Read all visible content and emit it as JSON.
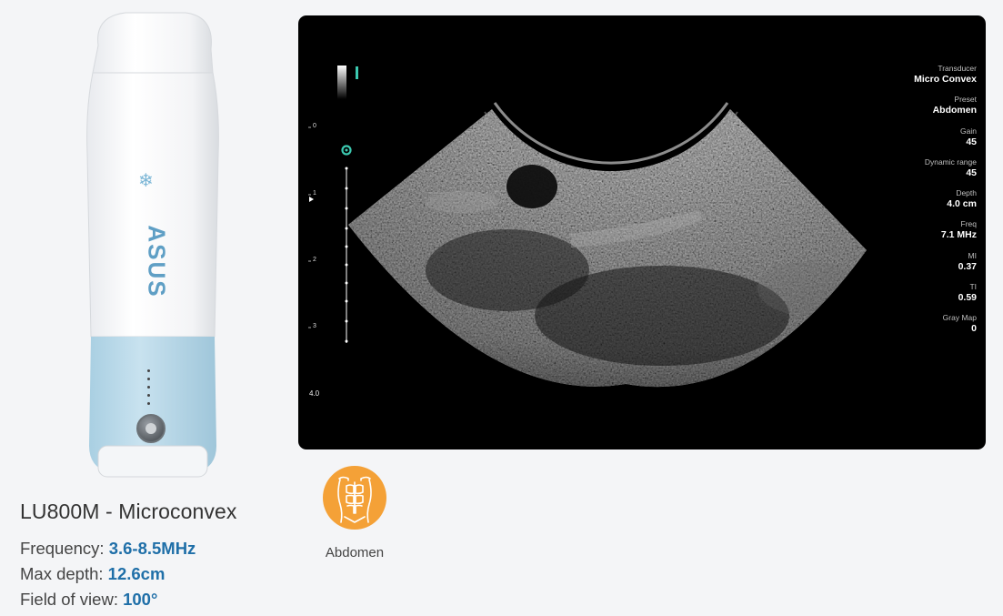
{
  "product": {
    "title": "LU800M - Microconvex",
    "specs": [
      {
        "label": "Frequency:",
        "value": "3.6-8.5MHz"
      },
      {
        "label": "Max depth:",
        "value": "12.6cm"
      },
      {
        "label": "Field of view:",
        "value": "100°"
      }
    ],
    "probe_brand": "ASUS"
  },
  "scan": {
    "depth_ticks": [
      "0",
      "1",
      "2",
      "3"
    ],
    "depth_max": "4.0",
    "params": [
      {
        "label": "Transducer",
        "value": "Micro Convex"
      },
      {
        "label": "Preset",
        "value": "Abdomen"
      },
      {
        "label": "Gain",
        "value": "45"
      },
      {
        "label": "Dynamic range",
        "value": "45"
      },
      {
        "label": "Depth",
        "value": "4.0 cm"
      },
      {
        "label": "Freq",
        "value": "7.1 MHz"
      },
      {
        "label": "MI",
        "value": "0.37"
      },
      {
        "label": "TI",
        "value": "0.59"
      },
      {
        "label": "Gray Map",
        "value": "0"
      }
    ]
  },
  "preset": {
    "label": "Abdomen",
    "icon": "abdomen-icon",
    "color": "#f4a137"
  },
  "colors": {
    "accent": "#1f6fa8",
    "focus_marker": "#3cc9b0",
    "probe_band": "#b7d9ea"
  }
}
